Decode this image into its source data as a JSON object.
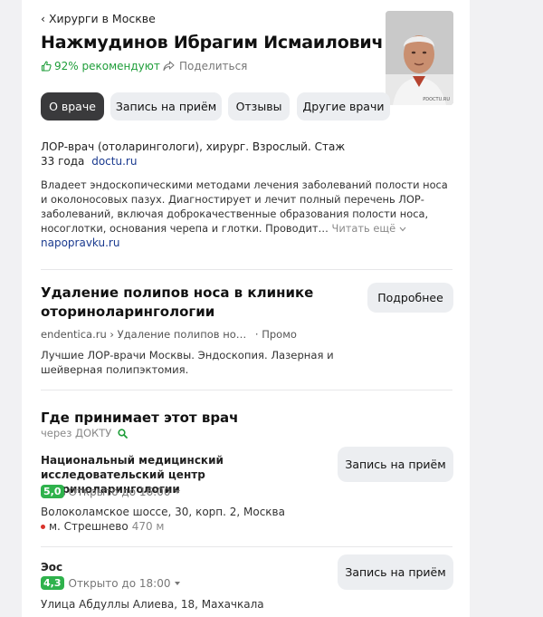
{
  "breadcrumb": "‹ Хирурги в Москве",
  "doctor": {
    "name": "Нажмудинов Ибрагим Исмаилович",
    "recommend": "92% рекомендуют",
    "share": "Поделиться",
    "photo_watermark": "PDOCTU.RU",
    "specialty": "ЛОР-врач (отоларингологи), хирург. Взрослый. Стаж 33 года",
    "specialty_source": "doctu.ru",
    "description": "Владеет эндоскопическими методами лечения заболеваний полости носа и околоносовых пазух. Диагностирует и лечит полный перечень ЛОР-заболеваний, включая доброкачественные образования полости носа, носоглотки, основания черепа и глотки. Проводит…",
    "read_more": "Читать ещё",
    "description_source": "napopravku.ru"
  },
  "tabs": [
    {
      "label": "О враче"
    },
    {
      "label": "Запись на приём"
    },
    {
      "label": "Отзывы"
    },
    {
      "label": "Другие врачи"
    }
  ],
  "promo": {
    "title": "Удаление полипов носа в клинике оториноларингологии",
    "button": "Подробнее",
    "url": "endentica.ru › Удаление полипов но…",
    "tag": "· Промо",
    "text": "Лучшие ЛОР-врачи Москвы. Эндоскопия. Лазерная и шейверная полипэктомия."
  },
  "clinics_section": {
    "title": "Где принимает этот врач",
    "via": "через ДОКТУ",
    "items": [
      {
        "name": "Национальный медицинский исследовательский центр оториноларингологии",
        "rating": "5,0",
        "hours": "Открыто до 16:00",
        "address": "Волоколамское шоссе, 30, корп. 2, Москва",
        "metro": "м. Стрешнево",
        "distance": "470 м",
        "button": "Запись на приём"
      },
      {
        "name": "Эос",
        "rating": "4,3",
        "hours": "Открыто до 18:00",
        "address": "Улица Абдуллы Алиева, 18, Махачкала",
        "button": "Запись на приём"
      }
    ]
  },
  "colors": {
    "green": "#1f9e3a",
    "rating_green": "#2fb24c",
    "link": "#1a3a8f",
    "active_tab": "#3a3a3c",
    "metro_red": "#d9332b"
  }
}
